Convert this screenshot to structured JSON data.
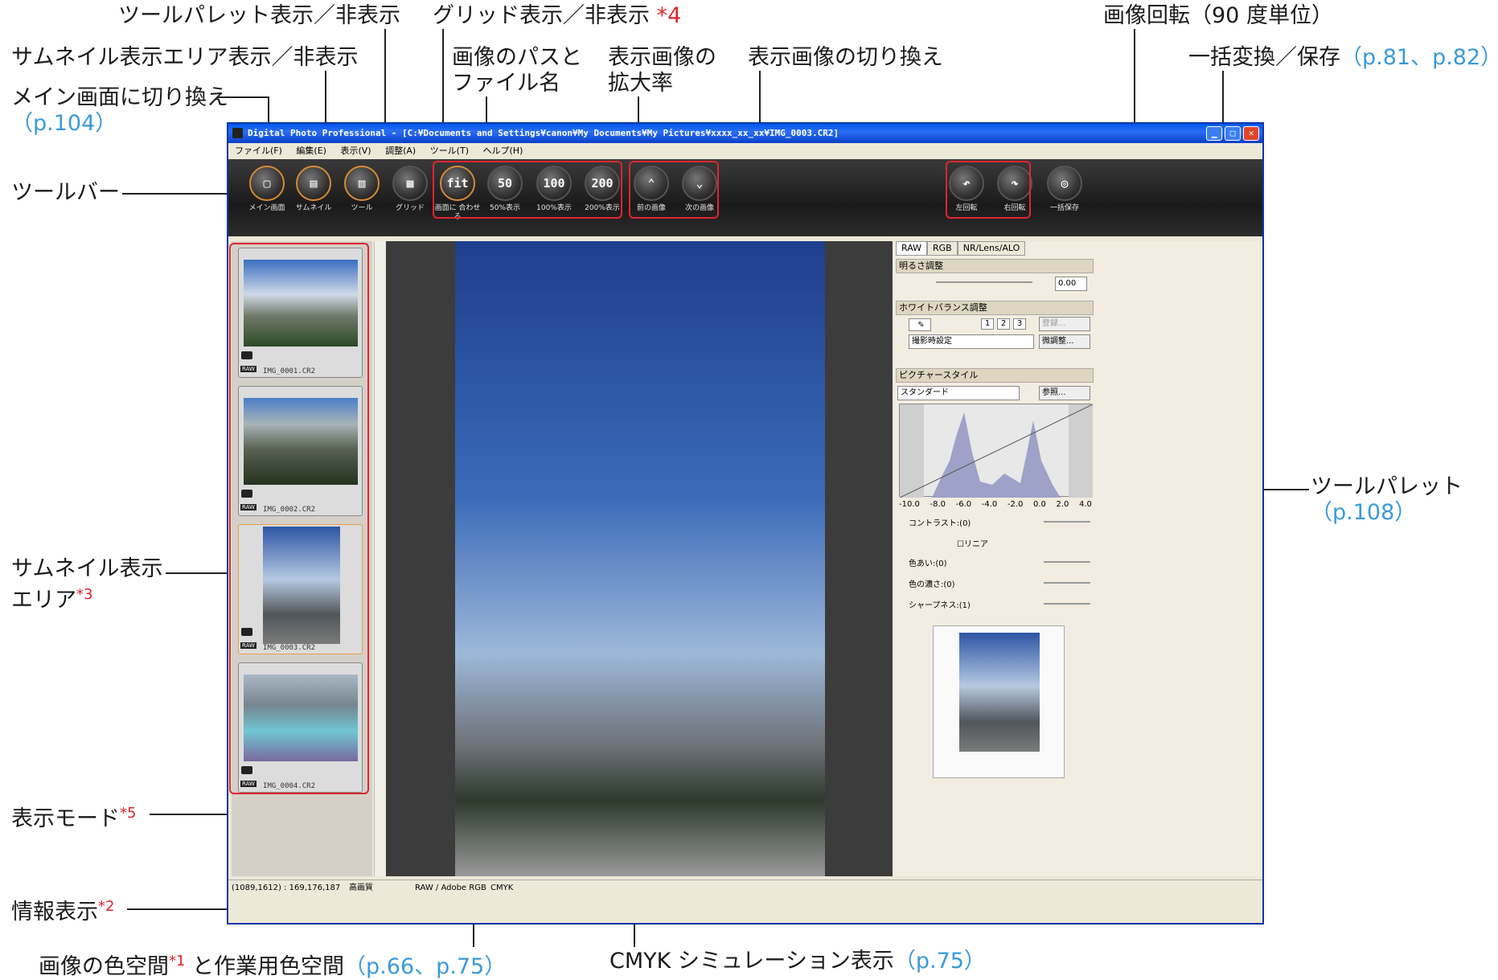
{
  "annotations": {
    "toolpalette_toggle": "ツールパレット表示／非表示",
    "grid_toggle": "グリッド表示／非表示",
    "grid_toggle_mark": "*4",
    "thumb_area_toggle": "サムネイル表示エリア表示／非表示",
    "image_path_l1": "画像のパスと",
    "image_path_l2": "ファイル名",
    "zoom_l1": "表示画像の",
    "zoom_l2": "拡大率",
    "switch_image": "表示画像の切り換え",
    "rotate": "画像回転（90 度単位）",
    "batch": "一括変換／保存",
    "batch_ref": "（p.81、p.82）",
    "main_switch": "メイン画面に切り換え",
    "main_switch_ref": "（p.104）",
    "toolbar": "ツールバー",
    "thumb_area_l1": "サムネイル表示",
    "thumb_area_l2": "エリア",
    "thumb_area_mark": "*3",
    "tool_palette": "ツールパレット",
    "tool_palette_ref": "（p.108）",
    "display_mode": "表示モード",
    "display_mode_mark": "*5",
    "info_display": "情報表示",
    "info_display_mark": "*2",
    "colorspace_a": "画像の色空間",
    "colorspace_mark": "*1",
    "colorspace_b": "と作業用色空間",
    "colorspace_ref": "（p.66、p.75）",
    "cmyk": "CMYK シミュレーション表示",
    "cmyk_ref": "（p.75）"
  },
  "window": {
    "title": "Digital Photo Professional - [C:¥Documents and Settings¥canon¥My Documents¥My Pictures¥xxxx_xx_xx¥IMG_0003.CR2]",
    "menu": [
      "ファイル(F)",
      "編集(E)",
      "表示(V)",
      "調整(A)",
      "ツール(T)",
      "ヘルプ(H)"
    ]
  },
  "toolbar": [
    {
      "glyph": "▢",
      "label": "メイン画面"
    },
    {
      "glyph": "▤",
      "label": "サムネイル"
    },
    {
      "glyph": "▥",
      "label": "ツール"
    },
    {
      "glyph": "▦",
      "label": "グリッド"
    },
    {
      "glyph": "fit",
      "label": "画面に 合わせる"
    },
    {
      "glyph": "50",
      "label": "50%表示"
    },
    {
      "glyph": "100",
      "label": "100%表示"
    },
    {
      "glyph": "200",
      "label": "200%表示"
    },
    {
      "glyph": "⌃",
      "label": "前の画像"
    },
    {
      "glyph": "⌄",
      "label": "次の画像"
    },
    {
      "glyph": "↶",
      "label": "左回転"
    },
    {
      "glyph": "↷",
      "label": "右回転"
    },
    {
      "glyph": "◎",
      "label": "一括保存"
    }
  ],
  "thumbnails": [
    {
      "file": "IMG_0001.CR2",
      "raw": "RAW"
    },
    {
      "file": "IMG_0002.CR2",
      "raw": "RAW"
    },
    {
      "file": "IMG_0003.CR2",
      "raw": "RAW"
    },
    {
      "file": "IMG_0004.CR2",
      "raw": "RAW"
    }
  ],
  "palette": {
    "tabs": [
      "RAW",
      "RGB",
      "NR/Lens/ALO"
    ],
    "brightness": "明るさ調整",
    "brightness_value": "0.00",
    "wb": "ホワイトバランス調整",
    "wb_buttons": [
      "1",
      "2",
      "3"
    ],
    "wb_register": "登録...",
    "wb_select": "撮影時設定",
    "wb_fine": "微調整...",
    "picture_style": "ピクチャースタイル",
    "ps_select": "スタンダード",
    "ps_browse": "参照...",
    "hist_axis": [
      "-10.0",
      "-8.0",
      "-6.0",
      "-4.0",
      "-2.0",
      "0.0",
      "2.0",
      "4.0"
    ],
    "contrast": "コントラスト:(0)",
    "linear": "リニア",
    "hue": "色あい:(0)",
    "saturation": "色の濃さ:(0)",
    "sharpness": "シャープネス:(1)"
  },
  "status": {
    "coords": "(1089,1612) : 169,176,187",
    "quality": "高画質",
    "colorspace": "RAW / Adobe RGB",
    "cmyk": "CMYK"
  }
}
